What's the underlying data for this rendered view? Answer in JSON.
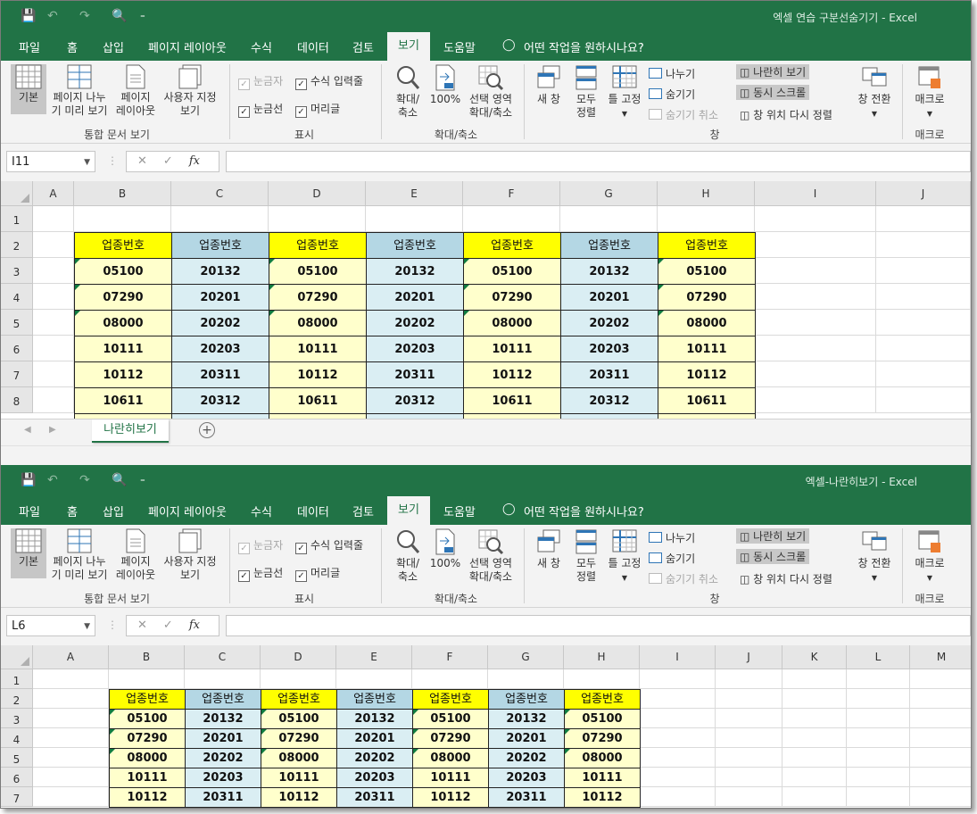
{
  "colors": {
    "excel_green": "#217346",
    "yellow": "#ffff00",
    "light_yellow": "#ffffcc",
    "blue_header": "#b4d7e4",
    "light_blue": "#daeef3"
  },
  "quick_access": {
    "save_icon": "save-icon",
    "undo_icon": "undo-icon",
    "redo_icon": "redo-icon",
    "preview_icon": "print-preview-icon",
    "customize_glyph": "⁼"
  },
  "tabs": [
    "파일",
    "홈",
    "삽입",
    "페이지 레이아웃",
    "수식",
    "데이터",
    "검토",
    "보기",
    "도움말"
  ],
  "tell_me": "어떤 작업을 원하시나요?",
  "ribbon": {
    "btn_normal": "기본",
    "btn_page_break_1": "페이지 나누",
    "btn_page_break_2": "기 미리 보기",
    "btn_page_layout_1": "페이지",
    "btn_page_layout_2": "레이아웃",
    "btn_custom_views_1": "사용자 지정",
    "btn_custom_views_2": "보기",
    "group_views": "통합 문서 보기",
    "chk_ruler": "눈금자",
    "chk_formula_bar": "수식 입력줄",
    "chk_gridlines": "눈금선",
    "chk_headings": "머리글",
    "group_show": "표시",
    "btn_zoom_1": "확대/",
    "btn_zoom_2": "축소",
    "btn_100": "100%",
    "btn_zoom_sel_1": "선택 영역",
    "btn_zoom_sel_2": "확대/축소",
    "group_zoom": "확대/축소",
    "btn_new_window": "새 창",
    "btn_arrange_1": "모두",
    "btn_arrange_2": "정렬",
    "btn_freeze": "틀 고정",
    "btn_split": "나누기",
    "btn_hide": "숨기기",
    "btn_unhide": "숨기기 취소",
    "btn_side_by_side": "나란히 보기",
    "btn_sync_scroll": "동시 스크롤",
    "btn_reset_pos": "창 위치 다시 정렬",
    "group_window": "창",
    "btn_switch_1": "창 전환",
    "btn_macros": "매크로",
    "group_macros": "매크로"
  },
  "fx_label": "fx",
  "window1": {
    "title": "엑셀 연습 구분선숨기기 - Excel",
    "name_box": "I11",
    "columns": [
      "A",
      "B",
      "C",
      "D",
      "E",
      "F",
      "G",
      "H",
      "I",
      "J"
    ],
    "rows": [
      "1",
      "2",
      "3",
      "4",
      "5",
      "6",
      "7",
      "8"
    ],
    "sheet_tab": "나란히보기"
  },
  "window2": {
    "title": "엑셀-나란히보기 - Excel",
    "name_box": "L6",
    "columns": [
      "A",
      "B",
      "C",
      "D",
      "E",
      "F",
      "G",
      "H",
      "I",
      "J",
      "K",
      "L",
      "M"
    ],
    "rows": [
      "1",
      "2",
      "3",
      "4",
      "5",
      "6",
      "7"
    ]
  },
  "table": {
    "header": "업종번호",
    "col_odd": [
      "05100",
      "07290",
      "08000",
      "10111",
      "10112",
      "10611"
    ],
    "col_even": [
      "20132",
      "20201",
      "20202",
      "20203",
      "20311",
      "20312"
    ]
  }
}
